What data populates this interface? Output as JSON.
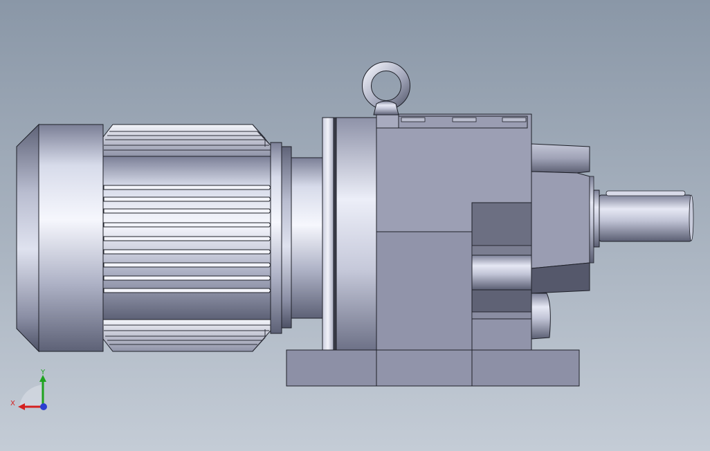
{
  "view": {
    "background_top": "#8a97a7",
    "background_bottom": "#c4ccd6"
  },
  "triad": {
    "x_label": "X",
    "y_label": "Y",
    "x_color": "#d42020",
    "y_color": "#1fa31f",
    "z_color": "#2a3fd0"
  },
  "model": {
    "steel_light": "#eef0fa",
    "steel_mid": "#b5b9cc",
    "steel_dark": "#6c7086",
    "housing": "#9a9db2",
    "housing_dark": "#6e7183",
    "outline": "#1e2028"
  }
}
